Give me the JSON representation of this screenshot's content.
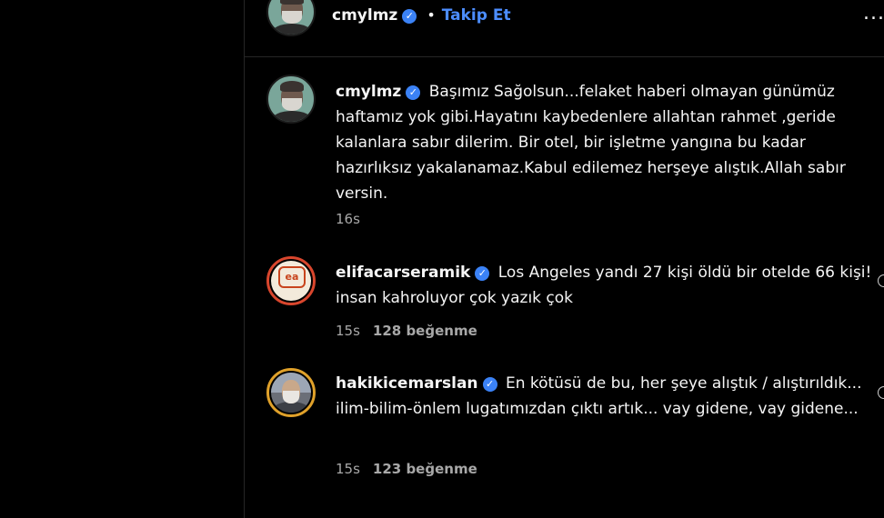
{
  "header": {
    "username": "cmylmz",
    "separator": "•",
    "follow_label": "Takip Et",
    "more_label": "..."
  },
  "comments": [
    {
      "username": "cmylmz",
      "text": "Başımız Sağolsun...felaket haberi olmayan günümüz haftamız yok gibi.Hayatını kaybedenlere allahtan rahmet ,geride kalanlara sabır dilerim. Bir otel, bir işletme yangına bu kadar hazırlıksız yakalanamaz.Kabul edilemez herşeye alıştık.Allah sabır versin.",
      "time": "16s",
      "likes": ""
    },
    {
      "username": "elifacarseramik",
      "text": "Los Angeles yandı 27 kişi öldü bir otelde 66 kişi! insan kahroluyor çok yazık çok",
      "time": "15s",
      "likes": "128 beğenme"
    },
    {
      "username": "hakikicemarslan",
      "text": "En kötüsü de bu, her şeye alıştık / alıştırıldık... ilim-bilim-önlem lugatımızdan çıktı artık... vay gidene, vay gidene...",
      "time": "15s",
      "likes": "123 beğenme"
    }
  ],
  "avatar_logo_text": "ea",
  "colors": {
    "background": "#000000",
    "text": "#f5f5f5",
    "muted": "#a8a8a8",
    "link": "#4c8dff",
    "verified": "#3b82f6"
  },
  "icons": [
    "verified-badge-icon",
    "more-options-icon",
    "heart-icon"
  ]
}
